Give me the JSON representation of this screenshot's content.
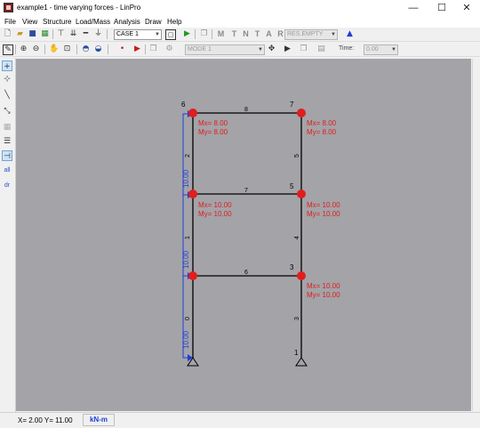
{
  "window": {
    "title": "example1 - time varying forces - LinPro",
    "minimize": "—",
    "maximize": "☐",
    "close": "✕"
  },
  "menu": [
    "File",
    "View",
    "Structure",
    "Load/Mass",
    "Analysis",
    "Draw",
    "Help"
  ],
  "toolbar1": {
    "case_combo": "CASE 1",
    "result_combo": "RES.EMPTY",
    "letter_buttons": [
      "M",
      "T",
      "N",
      "T",
      "A",
      "R"
    ]
  },
  "toolbar2": {
    "mode_combo": "MODE 1",
    "time_label": "Time:",
    "time_combo": "0.00"
  },
  "left_toolbar": {
    "all_label": "all",
    "dr_label": "dr"
  },
  "status": {
    "coords": "X= 2.00  Y= 11.00",
    "units": "kN-m"
  },
  "colors": {
    "canvas": "#a3a3a8",
    "member": "#000000",
    "joint": "#e11d1d",
    "moment_text": "#e11d1d",
    "load_diagram": "#1f3fd6"
  },
  "model": {
    "joints": [
      {
        "id": "1",
        "moments": []
      },
      {
        "id": "2",
        "moments": []
      },
      {
        "id": "3",
        "moments": [
          "Mx= 10.00",
          "My= 10.00"
        ]
      },
      {
        "id": "4",
        "moments": [
          "Mx= 10.00",
          "My= 10.00"
        ]
      },
      {
        "id": "5",
        "moments": [
          "Mx= 10.00",
          "My= 10.00"
        ]
      },
      {
        "id": "6",
        "moments": [
          "Mx= 8.00",
          "My= 8.00"
        ]
      },
      {
        "id": "7",
        "moments": [
          "Mx= 8.00",
          "My= 8.00"
        ]
      },
      {
        "id": "8",
        "moments": [
          "Mx= 10.00",
          "My= 10.00"
        ]
      }
    ],
    "member_labels": [
      "0",
      "1",
      "2",
      "3",
      "4",
      "5",
      "6",
      "7",
      "8"
    ],
    "load_labels": [
      "10.00",
      "10.00",
      "10.00"
    ]
  }
}
